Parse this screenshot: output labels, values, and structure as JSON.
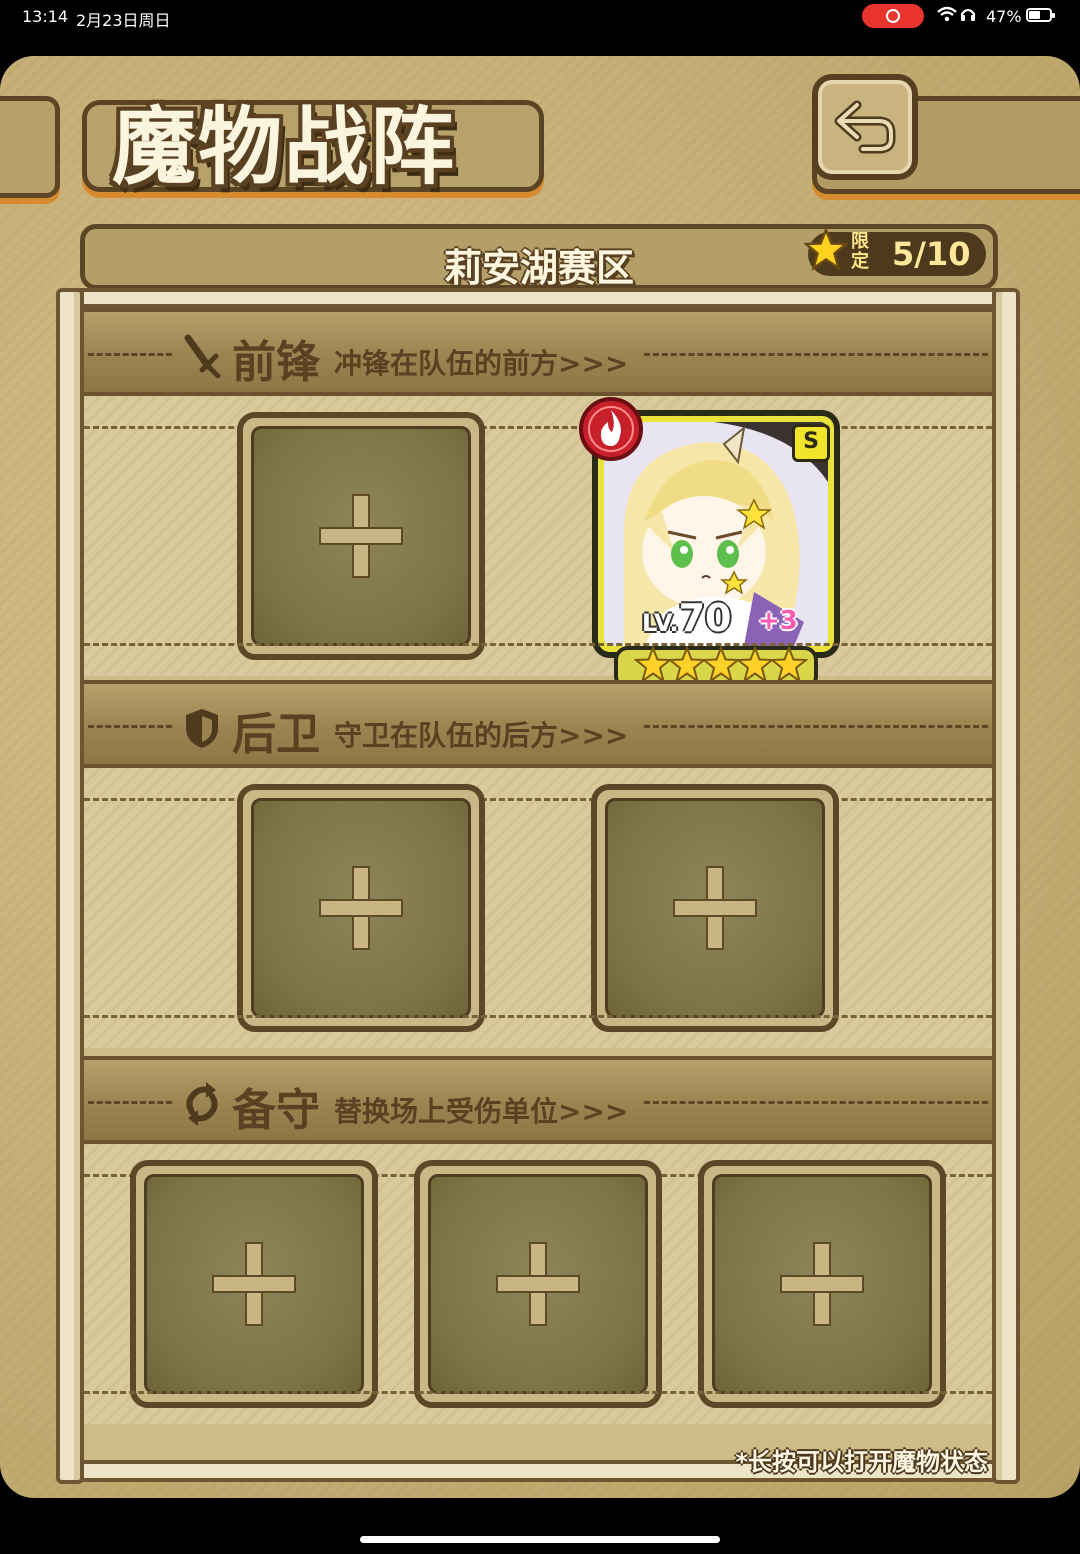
{
  "status_bar": {
    "time": "13:14",
    "date": "2月23日周日",
    "battery": "47%"
  },
  "page": {
    "title": "魔物战阵",
    "back_icon": "return-arrow-icon"
  },
  "roster": {
    "region": "莉安湖赛区",
    "limit_tag": "限定",
    "limit_count": "5/10"
  },
  "sections": [
    {
      "name": "前锋",
      "desc": "冲锋在队伍的前方>>>",
      "icon": "sword-icon"
    },
    {
      "name": "后卫",
      "desc": "守卫在队伍的后方>>>",
      "icon": "shield-icon"
    },
    {
      "name": "备守",
      "desc": "替换场上受伤单位>>>",
      "icon": "swap-icon"
    }
  ],
  "hero": {
    "level_prefix": "LV.",
    "level": "70",
    "bonus": "+3",
    "rank": "S",
    "stars": 5,
    "element": "fire-element-icon"
  },
  "footer": {
    "hint": "*长按可以打开魔物状态"
  },
  "colors": {
    "parchment": "#cdbb88",
    "border_brown": "#5e4726",
    "accent_orange": "#d78a2e",
    "card_yellow": "#e8e23a"
  }
}
